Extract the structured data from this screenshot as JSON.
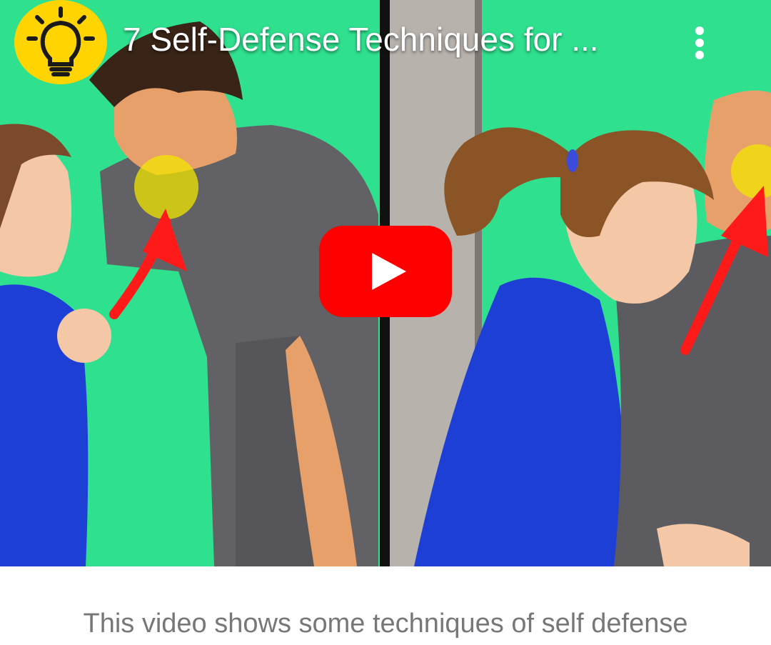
{
  "player": {
    "title": "7 Self-Defense Techniques for ...",
    "channel_icon": "lightbulb-icon",
    "more_icon": "more-vertical-icon",
    "play_icon": "youtube-play-icon"
  },
  "caption": "This video shows some techniques of self defense",
  "colors": {
    "background": "#2fe08f",
    "play_red": "#ff0000",
    "avatar_yellow": "#ffd400",
    "caption_gray": "#777777"
  }
}
